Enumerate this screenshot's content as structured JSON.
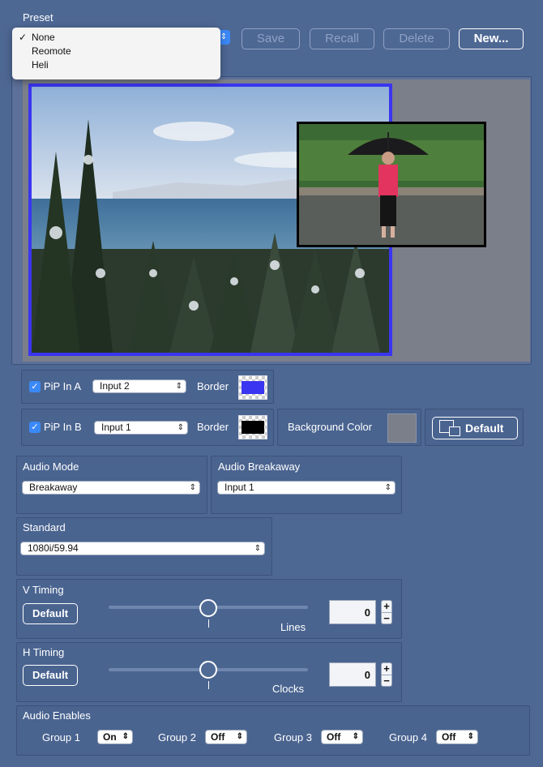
{
  "preset": {
    "label": "Preset",
    "menu_items": [
      {
        "label": "None",
        "checked": true
      },
      {
        "label": "Reomote",
        "checked": false
      },
      {
        "label": "Heli",
        "checked": false
      }
    ],
    "check_mark": "✓",
    "buttons": {
      "save": "Save",
      "recall": "Recall",
      "delete": "Delete",
      "new": "New..."
    }
  },
  "pip": {
    "a": {
      "label": "PiP In A",
      "checked": true,
      "input": "Input 2",
      "border_label": "Border",
      "border_color": "#3a35f0"
    },
    "b": {
      "label": "PiP In B",
      "checked": true,
      "input": "Input 1",
      "border_label": "Border",
      "border_color": "#000000"
    },
    "background_color_label": "Background Color",
    "background_color": "#7b7f8a",
    "default_button": "Default"
  },
  "audio_mode": {
    "label": "Audio Mode",
    "value": "Breakaway"
  },
  "audio_breakaway": {
    "label": "Audio Breakaway",
    "value": "Input 1"
  },
  "standard": {
    "label": "Standard",
    "value": "1080i/59.94"
  },
  "v_timing": {
    "label": "V Timing",
    "default_button": "Default",
    "units": "Lines",
    "value": "0",
    "plus": "+",
    "minus": "−",
    "slider_level": 0.5
  },
  "h_timing": {
    "label": "H Timing",
    "default_button": "Default",
    "units": "Clocks",
    "value": "0",
    "plus": "+",
    "minus": "−",
    "slider_level": 0.5
  },
  "audio_enables": {
    "label": "Audio Enables",
    "groups": [
      {
        "label": "Group 1",
        "value": "On"
      },
      {
        "label": "Group 2",
        "value": "Off"
      },
      {
        "label": "Group 3",
        "value": "Off"
      },
      {
        "label": "Group 4",
        "value": "Off"
      }
    ]
  },
  "colors": {
    "background": "#4e6894",
    "accent": "#3b89f7",
    "preview_bg": "#7b7f8a"
  },
  "icons": {
    "select_arrow": "⇕",
    "default_button_icon": "pip-layout-icon"
  }
}
